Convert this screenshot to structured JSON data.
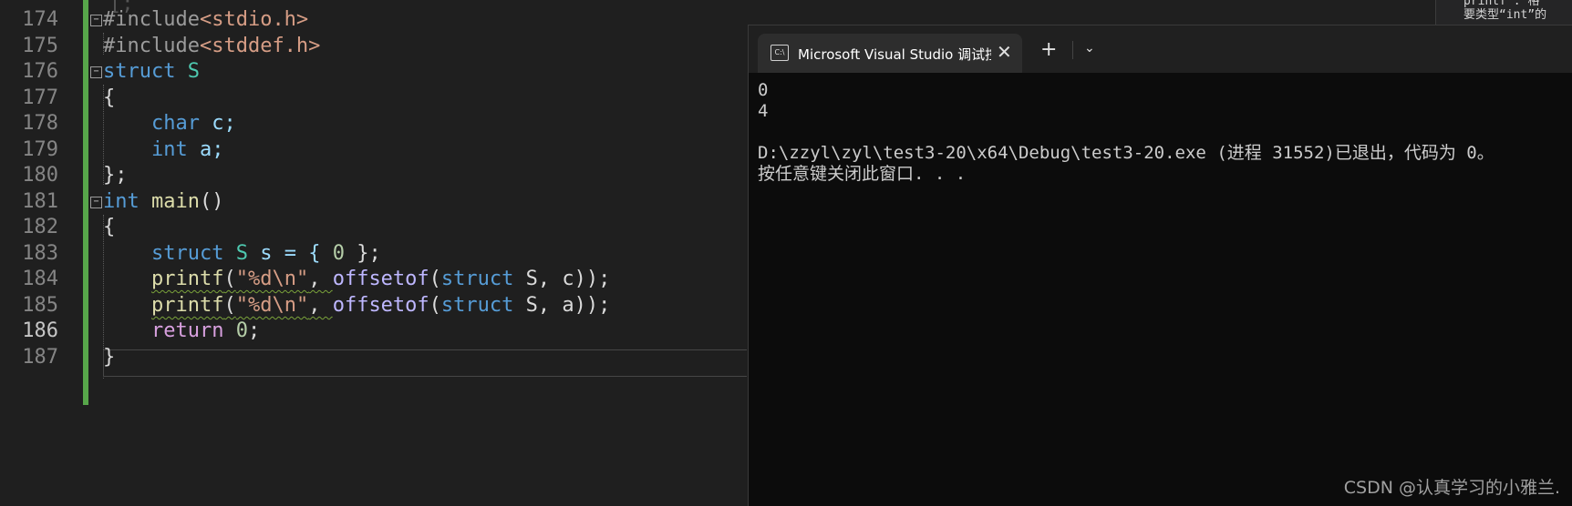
{
  "editor": {
    "lines": [
      {
        "num": "174"
      },
      {
        "num": "175"
      },
      {
        "num": "176"
      },
      {
        "num": "177"
      },
      {
        "num": "178"
      },
      {
        "num": "179"
      },
      {
        "num": "180"
      },
      {
        "num": "181"
      },
      {
        "num": "182"
      },
      {
        "num": "183"
      },
      {
        "num": "184"
      },
      {
        "num": "185"
      },
      {
        "num": "186"
      },
      {
        "num": "187"
      }
    ],
    "code": {
      "l174_kw": "#include",
      "l174_hdr": "<stdio.h>",
      "l175_kw": "#include",
      "l175_hdr": "<stddef.h>",
      "l176_kw": "struct",
      "l176_name": "S",
      "l177": "{",
      "l178_kw": "char",
      "l178_var": "c;",
      "l179_kw": "int",
      "l179_var": "a;",
      "l180": "};",
      "l181_kw": "int",
      "l181_fn": "main",
      "l181_par": "()",
      "l182": "{",
      "l183_kw": "struct",
      "l183_ty": "S",
      "l183_rest": "s = { ",
      "l183_num": "0",
      "l183_end": " };",
      "l184_fn": "printf",
      "l184_str": "\"%d\\n\"",
      "l184_macro": "offsetof",
      "l184_kw": "struct",
      "l184_args": "S, c",
      "l185_fn": "printf",
      "l185_str": "\"%d\\n\"",
      "l185_macro": "offsetof",
      "l185_kw": "struct",
      "l185_args": "S, a",
      "l186_kw": "return",
      "l186_num": "0",
      "l187": "}"
    }
  },
  "tooltip": {
    "line1": "printf : 格",
    "line2": "要类型“int”的"
  },
  "console": {
    "tab_title": "Microsoft Visual Studio 调试控",
    "new_tab": "+",
    "dropdown": "⌄",
    "close": "✕",
    "output": [
      "0",
      "4",
      "",
      "D:\\zzyl\\zyl\\test3-20\\x64\\Debug\\test3-20.exe (进程 31552)已退出，代码为 0。",
      "按任意键关闭此窗口. . ."
    ]
  },
  "watermark": "CSDN @认真学习的小雅兰."
}
